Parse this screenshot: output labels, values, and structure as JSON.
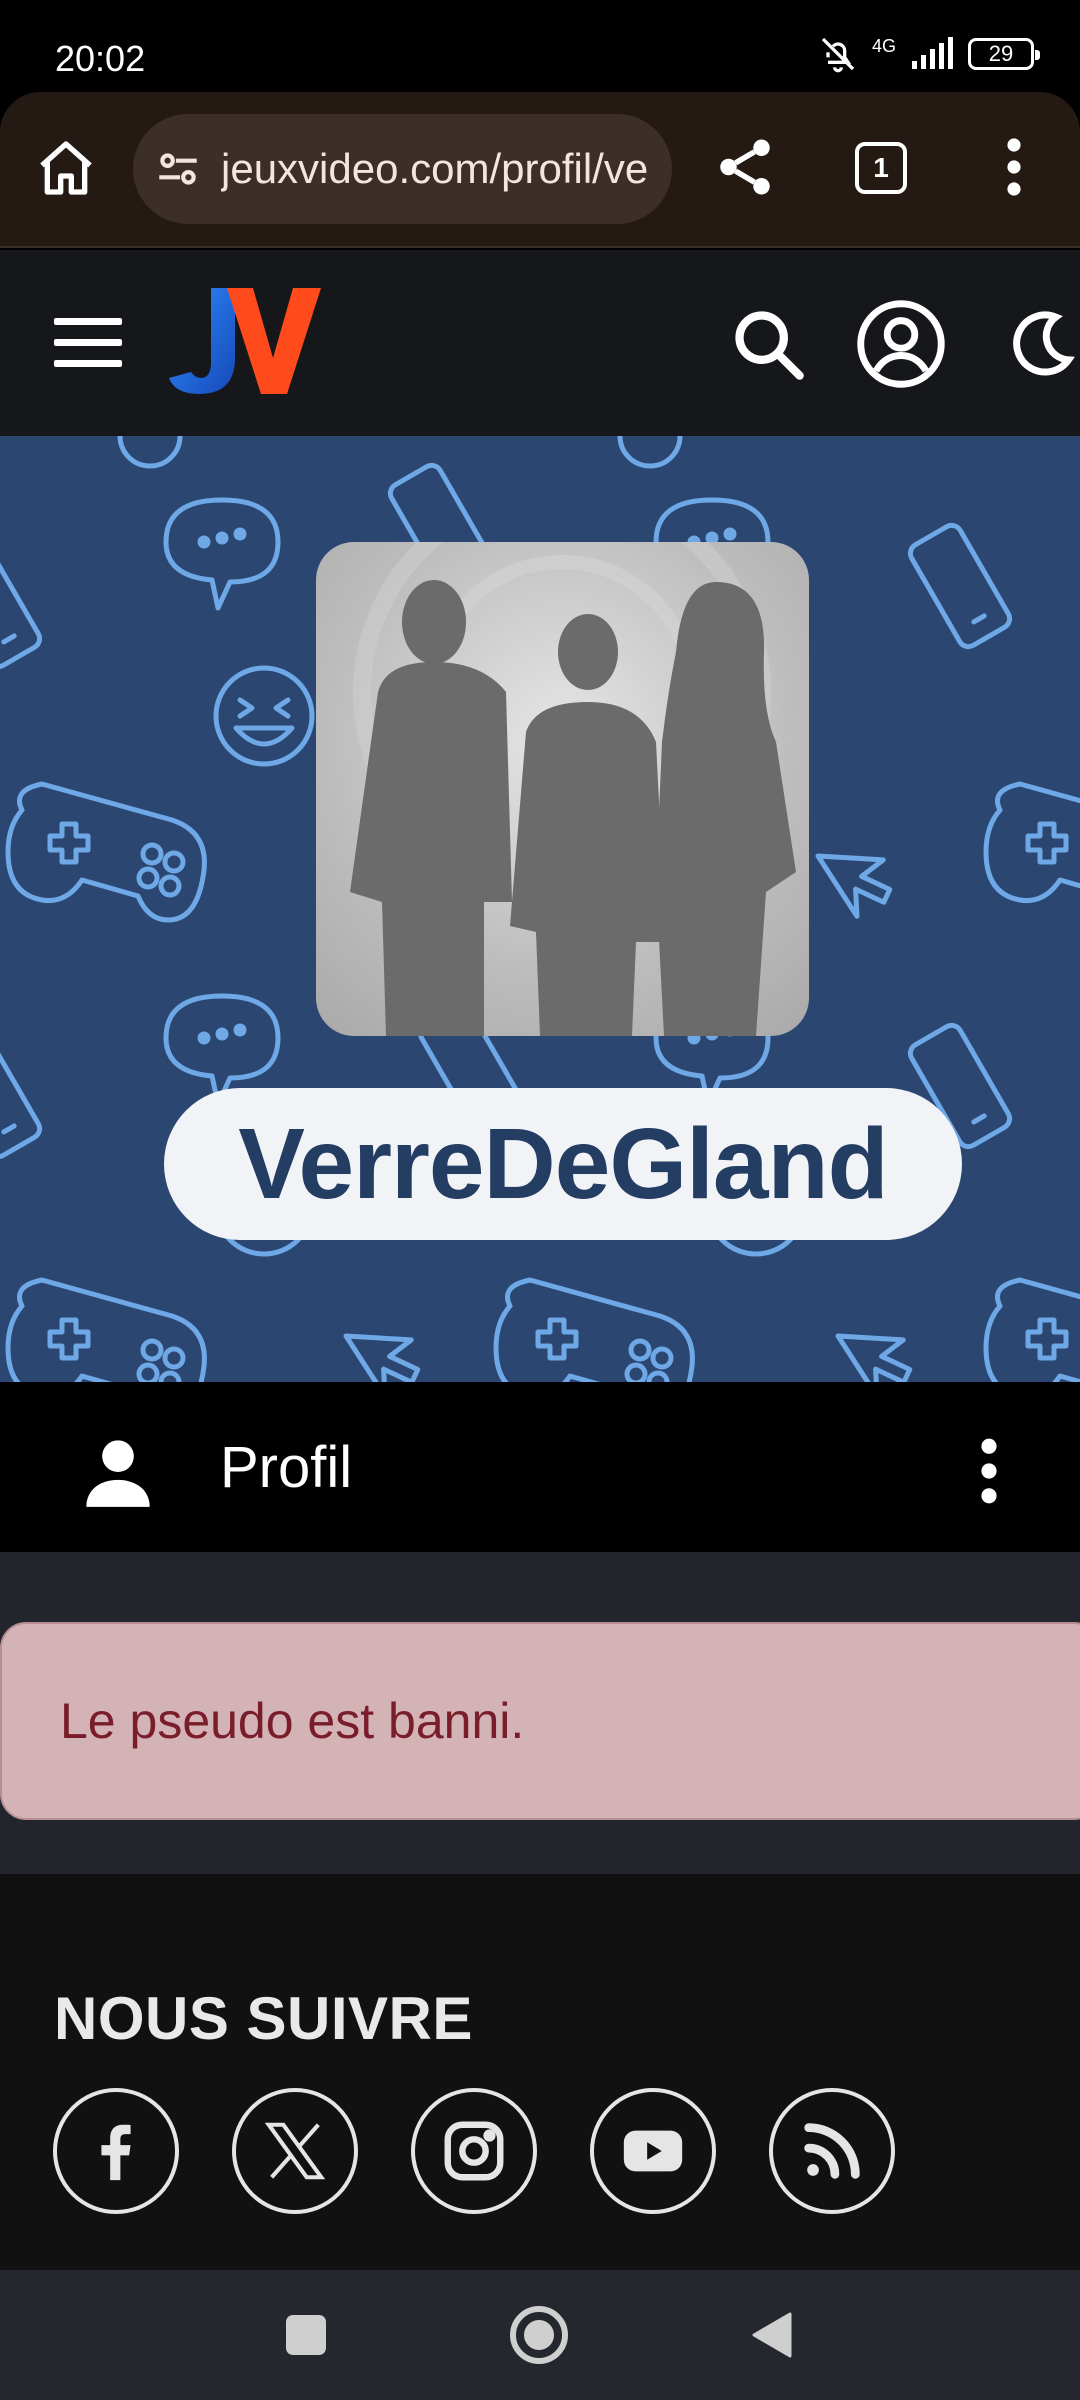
{
  "status_bar": {
    "time": "20:02",
    "network": "4G",
    "battery": "29"
  },
  "browser": {
    "url": "jeuxvideo.com/profil/verredegland",
    "tab_count": "1",
    "icons": [
      "home-icon",
      "tune-icon",
      "share-icon",
      "tabs-icon",
      "more-vert-icon"
    ]
  },
  "header": {
    "logo_letters": "JV",
    "logo_colors": [
      "#1f6bd8",
      "#ff4a1c"
    ],
    "icons": [
      "menu-icon",
      "search-icon",
      "account-icon",
      "moon-icon"
    ]
  },
  "profile": {
    "pseudo": "VerreDeGland",
    "section_label": "Profil"
  },
  "alert": {
    "message": "Le pseudo est banni."
  },
  "footer": {
    "title": "NOUS SUIVRE",
    "social": [
      "facebook-icon",
      "x-icon",
      "instagram-icon",
      "youtube-icon",
      "rss-icon"
    ]
  },
  "colors": {
    "banner_bg": "#2b4670",
    "pattern": "#6ea8e6",
    "alert_bg": "#d4b3b7",
    "alert_text": "#7a1d2a",
    "pseudo_text": "#243d63"
  }
}
